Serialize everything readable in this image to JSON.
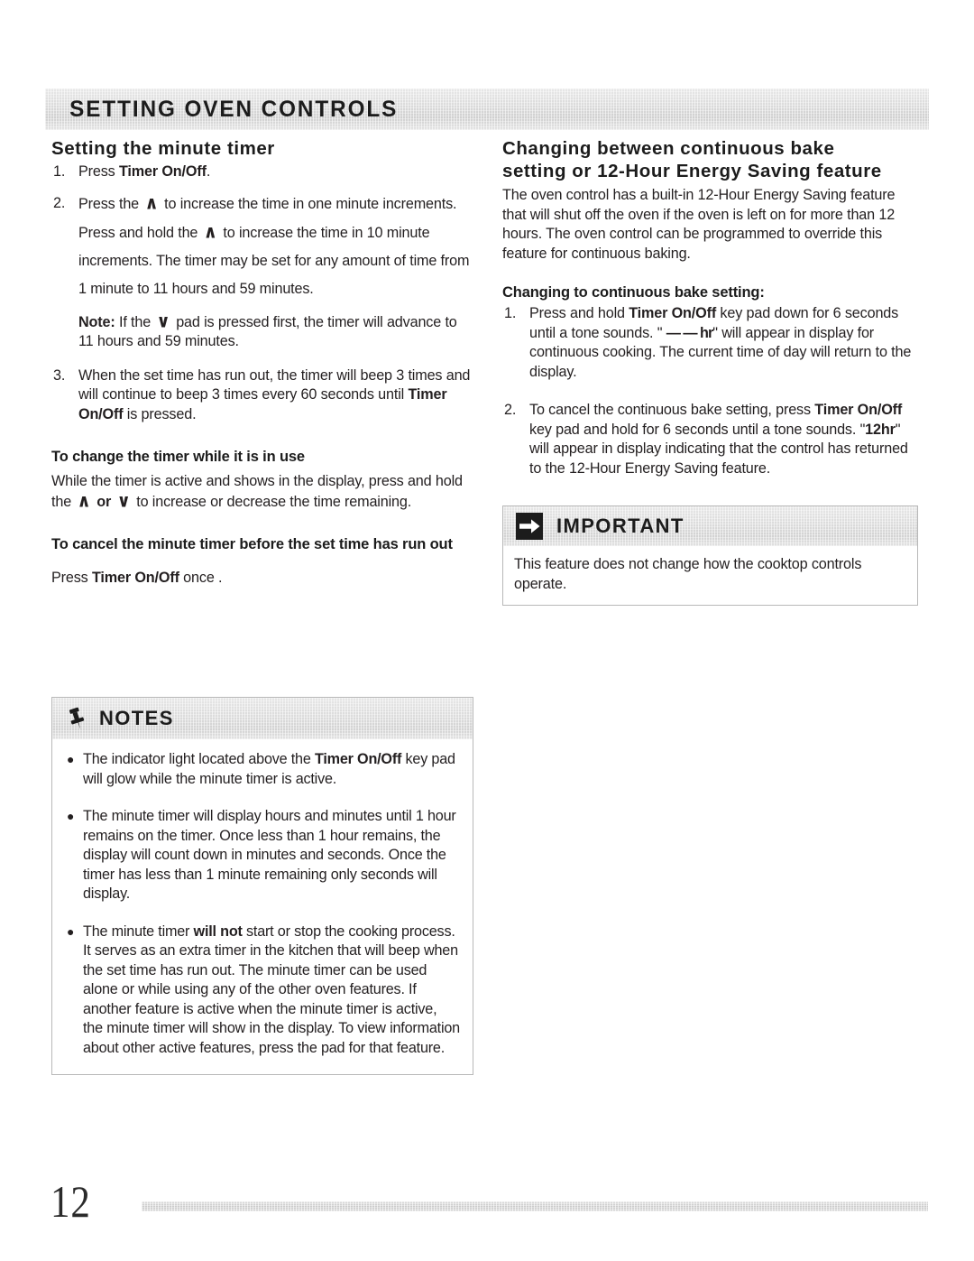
{
  "section_header": {
    "title": "SETTING OVEN CONTROLS"
  },
  "left_column": {
    "heading": "Setting the minute timer",
    "steps": [
      {
        "num": "1.",
        "parts": [
          {
            "t": "Press ",
            "style": "normal"
          },
          {
            "t": "Timer On/Off",
            "style": "bold"
          },
          {
            "t": ".",
            "style": "normal"
          }
        ]
      },
      {
        "num": "2.",
        "parts": [
          {
            "t": "Press the ",
            "style": "normal"
          },
          {
            "t": "∧",
            "style": "chevron"
          },
          {
            "t": " to increase the time in one minute increments. Press and hold the ",
            "style": "normal"
          },
          {
            "t": "∧",
            "style": "chevron"
          },
          {
            "t": " to increase the time in 10 minute increments. The timer may be set for any amount of time from 1 minute to 11 hours and 59 minutes.",
            "style": "normal"
          }
        ]
      }
    ],
    "note_line": {
      "label": "Note:",
      "parts": [
        {
          "t": " If the ",
          "style": "normal"
        },
        {
          "t": "∨",
          "style": "chevron"
        },
        {
          "t": " pad is pressed first, the timer will advance to 11 hours and 59 minutes.",
          "style": "normal"
        }
      ]
    },
    "step3": {
      "num": "3.",
      "parts": [
        {
          "t": "When the set time has run out, the timer will beep 3 times and will continue to beep 3 times every 60 seconds until ",
          "style": "normal"
        },
        {
          "t": "Timer On/Off",
          "style": "bold"
        },
        {
          "t": " is pressed.",
          "style": "normal"
        }
      ]
    },
    "change_timer": {
      "subheading": "To change the timer while it is in use",
      "parts": [
        {
          "t": "While the timer is active and shows in the display, press and hold the ",
          "style": "normal"
        },
        {
          "t": "∧",
          "style": "chevron"
        },
        {
          "t": " ",
          "style": "normal"
        },
        {
          "t": "or",
          "style": "bold"
        },
        {
          "t": " ",
          "style": "normal"
        },
        {
          "t": "∨",
          "style": "chevron"
        },
        {
          "t": " to increase or decrease the time remaining.",
          "style": "normal"
        }
      ]
    },
    "cancel_timer": {
      "subheading": "To cancel the minute timer before the set time has run out",
      "parts": [
        {
          "t": "Press ",
          "style": "normal"
        },
        {
          "t": "Timer On/Off",
          "style": "bold"
        },
        {
          "t": " once .",
          "style": "normal"
        }
      ]
    }
  },
  "notes_box": {
    "title": "NOTES",
    "icon": "pushpin-icon",
    "bullets": [
      {
        "marker": "●",
        "parts": [
          {
            "t": "The indicator light located above the ",
            "style": "normal"
          },
          {
            "t": "Timer On/Off",
            "style": "bold"
          },
          {
            "t": " key pad will glow while the minute timer is active.",
            "style": "normal"
          }
        ]
      },
      {
        "marker": "●",
        "parts": [
          {
            "t": "The minute timer will display hours and minutes until 1 hour remains on the timer. Once less than 1 hour remains, the display will count down in minutes and seconds. Once the timer has less than 1 minute remaining only seconds will display.",
            "style": "normal"
          }
        ]
      },
      {
        "marker": "●",
        "parts": [
          {
            "t": "The minute timer ",
            "style": "normal"
          },
          {
            "t": "will not",
            "style": "bold"
          },
          {
            "t": " start or stop the cooking process. It serves as an extra timer in the kitchen that will beep when the set time has run out. The minute timer can be used alone or while using any of the other oven features. If another feature is active when the minute timer is active, the minute timer will show in the display. To view information about other active features, press the pad for that feature.",
            "style": "normal"
          }
        ]
      }
    ]
  },
  "right_column": {
    "heading_line1": "Changing between continuous bake",
    "heading_line2": "setting or 12-Hour Energy Saving feature",
    "intro": "The oven control has a built-in 12-Hour Energy Saving feature that will shut off the oven if the oven is left on for more than 12 hours. The oven control can be programmed to override this feature for continuous baking.",
    "subheading": "Changing to continuous bake setting:",
    "steps": [
      {
        "num": "1.",
        "parts": [
          {
            "t": "Press and hold ",
            "style": "normal"
          },
          {
            "t": "Timer On/Off",
            "style": "bold"
          },
          {
            "t": " key pad down for 6 seconds until a tone sounds. \" ",
            "style": "normal"
          },
          {
            "t": "— — hr",
            "style": "bolddash"
          },
          {
            "t": "\" will appear in display for continuous cooking. The current time of day will return to the display.",
            "style": "normal"
          }
        ]
      },
      {
        "num": "2.",
        "parts": [
          {
            "t": "To cancel the continuous bake setting, press ",
            "style": "normal"
          },
          {
            "t": "Timer On/Off",
            "style": "bold"
          },
          {
            "t": " key pad and hold for 6 seconds until a tone sounds. \"",
            "style": "normal"
          },
          {
            "t": "12hr",
            "style": "bold"
          },
          {
            "t": "\" will appear in display indicating that the control has returned to the 12-Hour Energy Saving feature.",
            "style": "normal"
          }
        ]
      }
    ]
  },
  "important_box": {
    "title": "IMPORTANT",
    "icon": "arrow-right-icon",
    "body": "This feature does not change how the cooktop controls operate."
  },
  "footer": {
    "page_number": "12"
  }
}
